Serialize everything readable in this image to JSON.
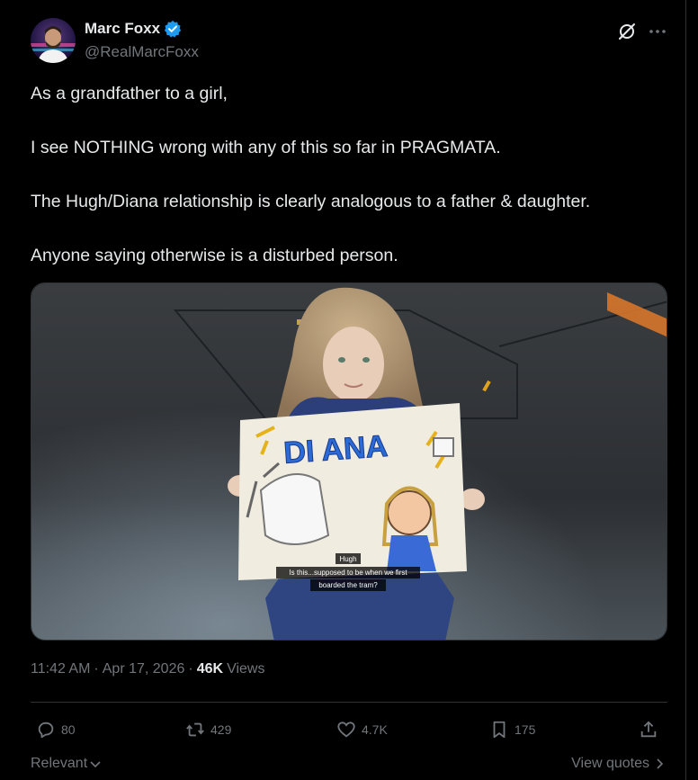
{
  "author": {
    "display_name": "Marc Foxx",
    "handle": "@RealMarcFoxx",
    "verified": true,
    "verified_color": "#1d9bf0"
  },
  "tweet": {
    "paragraphs": [
      "As a grandfather to a girl,",
      "I see NOTHING wrong with any of this so far in PRAGMATA.",
      "The Hugh/Diana relationship is clearly analogous to a father & daughter.",
      "Anyone saying otherwise is a disturbed person."
    ]
  },
  "media": {
    "drawing_title": "DI ANA",
    "subtitle_speaker": "Hugh",
    "subtitle_line1": "Is this...supposed to be when we first",
    "subtitle_line2": "boarded the tram?"
  },
  "meta": {
    "time": "11:42 AM",
    "separator": "·",
    "date": "Apr 17, 2026",
    "views_count": "46K",
    "views_label": "Views"
  },
  "actions": {
    "replies": "80",
    "reposts": "429",
    "likes": "4.7K",
    "bookmarks": "175"
  },
  "bottom": {
    "sort_label": "Relevant",
    "view_quotes": "View quotes"
  },
  "icons": {
    "verified": "verified-badge-icon",
    "grok": "grok-icon",
    "more": "more-icon",
    "reply": "reply-icon",
    "repost": "repost-icon",
    "like": "heart-icon",
    "bookmark": "bookmark-icon",
    "share": "share-icon",
    "chevron_down": "chevron-down-icon",
    "chevron_right": "chevron-right-icon"
  }
}
